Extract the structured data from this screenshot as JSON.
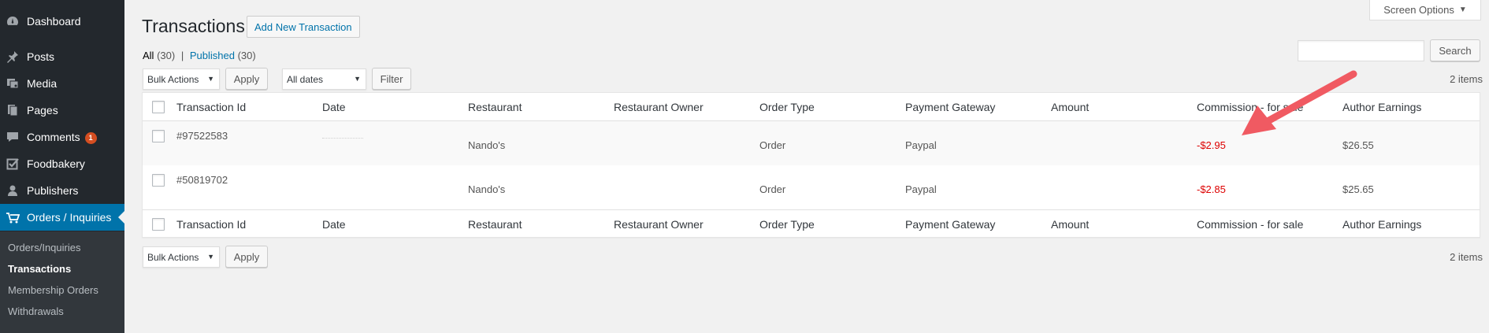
{
  "sidebar": {
    "items": [
      {
        "label": "Dashboard",
        "icon": "dashboard-icon"
      },
      {
        "label": "Posts",
        "icon": "pin-icon"
      },
      {
        "label": "Media",
        "icon": "media-icon"
      },
      {
        "label": "Pages",
        "icon": "pages-icon"
      },
      {
        "label": "Comments",
        "icon": "comments-icon",
        "badge": "1"
      },
      {
        "label": "Foodbakery",
        "icon": "checkbox-icon"
      },
      {
        "label": "Publishers",
        "icon": "users-icon"
      },
      {
        "label": "Orders / Inquiries",
        "icon": "cart-icon",
        "active": true
      }
    ],
    "submenu": [
      "Orders/Inquiries",
      "Transactions",
      "Membership Orders",
      "Withdrawals"
    ],
    "current_sub": "Transactions"
  },
  "screen_options": "Screen Options",
  "header": {
    "title": "Transactions",
    "add_new": "Add New Transaction"
  },
  "filters_links": {
    "all_label": "All",
    "all_count": "(30)",
    "separator": "|",
    "published_label": "Published",
    "published_count": "(30)"
  },
  "search": {
    "button": "Search",
    "value": ""
  },
  "top_nav": {
    "bulk_actions": "Bulk Actions",
    "apply": "Apply",
    "dates": "All dates",
    "filter": "Filter",
    "items": "2 items"
  },
  "bottom_nav": {
    "bulk_actions": "Bulk Actions",
    "apply": "Apply",
    "items": "2 items"
  },
  "table": {
    "columns": [
      "Transaction Id",
      "Date",
      "Restaurant",
      "Restaurant Owner",
      "Order Type",
      "Payment Gateway",
      "Amount",
      "Commission - for sale",
      "Author Earnings"
    ],
    "rows": [
      {
        "id": "#97522583",
        "date": "",
        "restaurant": "Nando's",
        "owner": "",
        "order_type": "Order",
        "gateway": "Paypal",
        "amount": "",
        "commission": "-$2.95",
        "earnings": "$26.55"
      },
      {
        "id": "#50819702",
        "date": "",
        "restaurant": "Nando's",
        "owner": "",
        "order_type": "Order",
        "gateway": "Paypal",
        "amount": "",
        "commission": "-$2.85",
        "earnings": "$25.65"
      }
    ]
  },
  "colors": {
    "sidebar_bg": "#23282d",
    "active_bg": "#0073aa",
    "link": "#0073aa",
    "negative": "#dd0000",
    "arrow": "#f05a62"
  }
}
